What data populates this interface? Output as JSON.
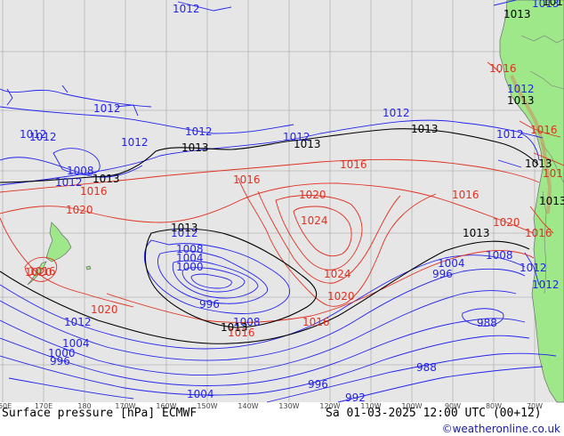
{
  "title": "Surface pressure [hPa] ECMWF",
  "valid_time": "Sa 01-03-2025 12:00 UTC (00+12)",
  "credit": "©weatheronline.co.uk",
  "colors": {
    "sea": "#e6e6e6",
    "land": "#9ee88a",
    "isobar_low": "#2222ee",
    "isobar_high": "#e03020",
    "isobar_1013": "#000000",
    "footer_bg": "#ffffff"
  },
  "lon_ticks": [
    "160E",
    "170E",
    "180",
    "170W",
    "160W",
    "150W",
    "140W",
    "130W",
    "120W",
    "110W",
    "100W",
    "90W",
    "80W",
    "70W"
  ],
  "isobar_labels": [
    {
      "id": "b1",
      "text": "1012",
      "kind": "low"
    },
    {
      "id": "b2",
      "text": "1012",
      "kind": "low"
    },
    {
      "id": "b3",
      "text": "1012",
      "kind": "low"
    },
    {
      "id": "b4",
      "text": "1012",
      "kind": "low"
    },
    {
      "id": "b5",
      "text": "1012",
      "kind": "low"
    },
    {
      "id": "b6",
      "text": "1012",
      "kind": "low"
    },
    {
      "id": "b7",
      "text": "1012",
      "kind": "low"
    },
    {
      "id": "b8",
      "text": "1012",
      "kind": "low"
    },
    {
      "id": "b9",
      "text": "1012",
      "kind": "low"
    },
    {
      "id": "b10",
      "text": "1008",
      "kind": "low"
    },
    {
      "id": "b11",
      "text": "1012",
      "kind": "low"
    },
    {
      "id": "b12",
      "text": "1012",
      "kind": "low"
    },
    {
      "id": "b13",
      "text": "1008",
      "kind": "low"
    },
    {
      "id": "b14",
      "text": "1004",
      "kind": "low"
    },
    {
      "id": "b15",
      "text": "1000",
      "kind": "low"
    },
    {
      "id": "b16",
      "text": "996",
      "kind": "low"
    },
    {
      "id": "b17",
      "text": "1008",
      "kind": "low"
    },
    {
      "id": "b18",
      "text": "1012",
      "kind": "low"
    },
    {
      "id": "b19",
      "text": "1004",
      "kind": "low"
    },
    {
      "id": "b20",
      "text": "1000",
      "kind": "low"
    },
    {
      "id": "b21",
      "text": "996",
      "kind": "low"
    },
    {
      "id": "b22",
      "text": "1004",
      "kind": "low"
    },
    {
      "id": "b23",
      "text": "996",
      "kind": "low"
    },
    {
      "id": "b24",
      "text": "1004",
      "kind": "low"
    },
    {
      "id": "b25",
      "text": "1008",
      "kind": "low"
    },
    {
      "id": "b26",
      "text": "996",
      "kind": "low"
    },
    {
      "id": "b27",
      "text": "988",
      "kind": "low"
    },
    {
      "id": "b28",
      "text": "988",
      "kind": "low"
    },
    {
      "id": "b29",
      "text": "992",
      "kind": "low"
    },
    {
      "id": "b30",
      "text": "1012",
      "kind": "low"
    },
    {
      "id": "b31",
      "text": "1012",
      "kind": "low"
    },
    {
      "id": "b32",
      "text": "1012",
      "kind": "low"
    },
    {
      "id": "b33",
      "text": "1013",
      "kind": "low"
    },
    {
      "id": "k1",
      "text": "1013",
      "kind": "ref"
    },
    {
      "id": "k2",
      "text": "1013",
      "kind": "ref"
    },
    {
      "id": "k3",
      "text": "1013",
      "kind": "ref"
    },
    {
      "id": "k4",
      "text": "1013",
      "kind": "ref"
    },
    {
      "id": "k5",
      "text": "1013",
      "kind": "ref"
    },
    {
      "id": "k6",
      "text": "1013",
      "kind": "ref"
    },
    {
      "id": "k7",
      "text": "1013",
      "kind": "ref"
    },
    {
      "id": "k8",
      "text": "1013",
      "kind": "ref"
    },
    {
      "id": "k9",
      "text": "1013",
      "kind": "ref"
    },
    {
      "id": "k10",
      "text": "1013",
      "kind": "ref"
    },
    {
      "id": "k11",
      "text": "1013",
      "kind": "ref"
    },
    {
      "id": "k12",
      "text": "1013",
      "kind": "ref"
    },
    {
      "id": "r1",
      "text": "1016",
      "kind": "high"
    },
    {
      "id": "r2",
      "text": "1016",
      "kind": "high"
    },
    {
      "id": "r3",
      "text": "1016",
      "kind": "high"
    },
    {
      "id": "r4",
      "text": "1020",
      "kind": "high"
    },
    {
      "id": "r5",
      "text": "1016",
      "kind": "high"
    },
    {
      "id": "r6",
      "text": "1020",
      "kind": "high"
    },
    {
      "id": "r7",
      "text": "1024",
      "kind": "high"
    },
    {
      "id": "r8",
      "text": "1024",
      "kind": "high"
    },
    {
      "id": "r9",
      "text": "1020",
      "kind": "high"
    },
    {
      "id": "r10",
      "text": "1016",
      "kind": "high"
    },
    {
      "id": "r11",
      "text": "1020",
      "kind": "high"
    },
    {
      "id": "r12",
      "text": "1016",
      "kind": "high"
    },
    {
      "id": "r13",
      "text": "1020",
      "kind": "high"
    },
    {
      "id": "r14",
      "text": "1016",
      "kind": "high"
    },
    {
      "id": "r15",
      "text": "1016",
      "kind": "high"
    },
    {
      "id": "r16",
      "text": "1016",
      "kind": "high"
    },
    {
      "id": "r17",
      "text": "1016",
      "kind": "high"
    },
    {
      "id": "r18",
      "text": "1020",
      "kind": "high"
    },
    {
      "id": "r19",
      "text": "1016",
      "kind": "high"
    }
  ]
}
